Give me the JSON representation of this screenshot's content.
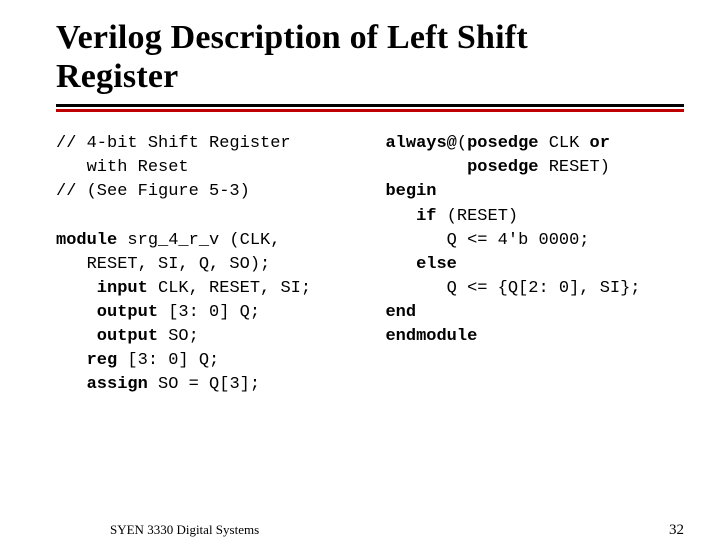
{
  "title_line1": "Verilog Description of Left Shift",
  "title_line2": "Register",
  "left": {
    "c1a": "// 4-bit Shift Register",
    "c1b": "   with Reset",
    "c2": "// (See Figure 5-3)",
    "m1a": "module",
    "m1b": " srg_4_r_v (CLK,",
    "m2": "   RESET, SI, Q, SO);",
    "m3a": "    input",
    "m3b": " CLK, RESET, SI;",
    "m4a": "    output",
    "m4b": " [3: 0] Q;",
    "m5a": "    output",
    "m5b": " SO;",
    "m6a": "   reg ",
    "m6b": "[3: 0] Q;",
    "m7a": "   assign ",
    "m7b": "SO = Q[3];"
  },
  "right": {
    "r1a": "always@",
    "r1b": "(",
    "r1c": "posedge",
    "r1d": " CLK ",
    "r1e": "or",
    "r2a": "        posedge",
    "r2b": " RESET)",
    "r3": "begin",
    "r4a": "   if ",
    "r4b": "(RESET)",
    "r5": "      Q <= 4'b 0000;",
    "r6": "   else",
    "r7": "      Q <= {Q[2: 0], SI};",
    "r8": "end",
    "r9": "endmodule"
  },
  "footer": {
    "left": "SYEN 3330 Digital Systems",
    "right": "32"
  }
}
